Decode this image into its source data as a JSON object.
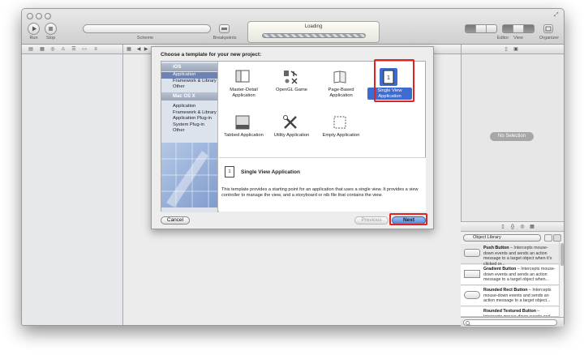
{
  "toolbar": {
    "run_label": "Run",
    "stop_label": "Stop",
    "scheme_label": "Scheme",
    "breakpoints_label": "Breakpoints",
    "activity_text": "Loading",
    "editor_label": "Editor",
    "view_label": "View",
    "organizer_label": "Organizer"
  },
  "sheet": {
    "title": "Choose a template for your new project:",
    "categories": {
      "ios_header": "iOS",
      "ios_items": [
        "Application",
        "Framework & Library",
        "Other"
      ],
      "mac_header": "Mac OS X",
      "mac_items": [
        "Application",
        "Framework & Library",
        "Application Plug-in",
        "System Plug-in",
        "Other"
      ]
    },
    "templates": [
      {
        "label": "Master-Detail Application",
        "icon": "master-detail-icon"
      },
      {
        "label": "OpenGL Game",
        "icon": "opengl-game-icon"
      },
      {
        "label": "Page-Based Application",
        "icon": "page-based-icon"
      },
      {
        "label": "Single View Application",
        "icon": "single-view-icon",
        "selected": true
      },
      {
        "label": "Tabbed Application",
        "icon": "tabbed-icon"
      },
      {
        "label": "Utility Application",
        "icon": "utility-icon"
      },
      {
        "label": "Empty Application",
        "icon": "empty-app-icon"
      }
    ],
    "detail": {
      "icon_glyph": "1",
      "name": "Single View Application",
      "description": "This template provides a starting point for an application that uses a single view. It provides a view controller to manage the view, and a storyboard or nib file that contains the view."
    },
    "cancel_label": "Cancel",
    "previous_label": "Previous",
    "next_label": "Next"
  },
  "inspector": {
    "no_selection": "No Selection"
  },
  "library": {
    "popup_label": "Object Library",
    "items": [
      {
        "name": "Push Button",
        "desc": " – Intercepts mouse-down events and sends an action message to a target object when it's clicked or..."
      },
      {
        "name": "Gradient Button",
        "desc": " – Intercepts mouse-down events and sends an action message to a target object when..."
      },
      {
        "name": "Rounded Rect Button",
        "desc": " – Intercepts mouse-down events and sends an action message to a target object..."
      },
      {
        "name": "Rounded Textured Button",
        "desc": " – Intercepts mouse-down events and sends..."
      }
    ]
  },
  "colors": {
    "selection_blue": "#3d6bd0",
    "highlight_red": "#e02424",
    "default_button": "#4f86d8"
  }
}
